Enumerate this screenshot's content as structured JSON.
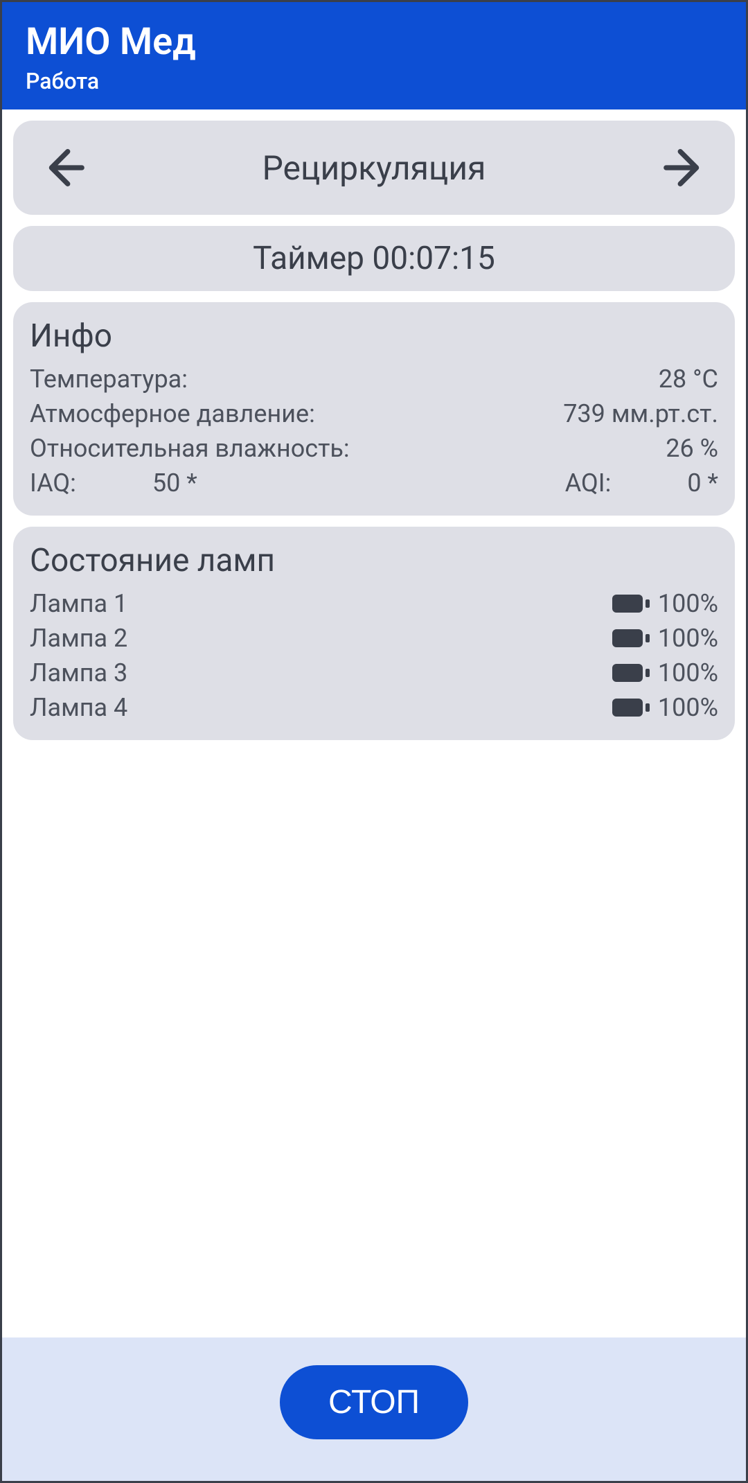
{
  "header": {
    "title": "МИО Мед",
    "subtitle": "Работа"
  },
  "mode": {
    "label": "Рециркуляция"
  },
  "timer": {
    "text": "Таймер 00:07:15"
  },
  "info": {
    "title": "Инфо",
    "rows": [
      {
        "label": "Температура:",
        "value": "28 °C"
      },
      {
        "label": "Атмосферное давление:",
        "value": "739 мм.рт.ст."
      },
      {
        "label": "Относительная влажность:",
        "value": "26 %"
      }
    ],
    "dual": {
      "l1": "IAQ:",
      "v1": "50 *",
      "l2": "AQI:",
      "v2": "0 *"
    }
  },
  "lamps": {
    "title": "Состояние ламп",
    "items": [
      {
        "name": "Лампа 1",
        "pct": "100%"
      },
      {
        "name": "Лампа 2",
        "pct": "100%"
      },
      {
        "name": "Лампа 3",
        "pct": "100%"
      },
      {
        "name": "Лампа 4",
        "pct": "100%"
      }
    ]
  },
  "footer": {
    "stop": "СТОП"
  }
}
